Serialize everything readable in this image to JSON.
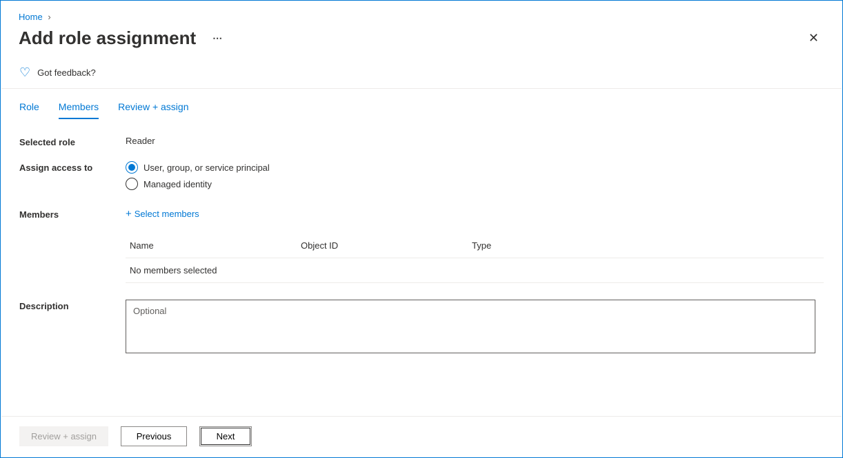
{
  "breadcrumb": {
    "home": "Home"
  },
  "page_title": "Add role assignment",
  "feedback_label": "Got feedback?",
  "tabs": {
    "role": "Role",
    "members": "Members",
    "review": "Review + assign"
  },
  "form": {
    "selected_role_label": "Selected role",
    "selected_role_value": "Reader",
    "assign_access_label": "Assign access to",
    "radio_user": "User, group, or service principal",
    "radio_managed": "Managed identity",
    "members_label": "Members",
    "select_members_link": "Select members",
    "table": {
      "name": "Name",
      "object_id": "Object ID",
      "type": "Type",
      "empty": "No members selected"
    },
    "description_label": "Description",
    "description_placeholder": "Optional"
  },
  "footer": {
    "review_assign": "Review + assign",
    "previous": "Previous",
    "next": "Next"
  }
}
